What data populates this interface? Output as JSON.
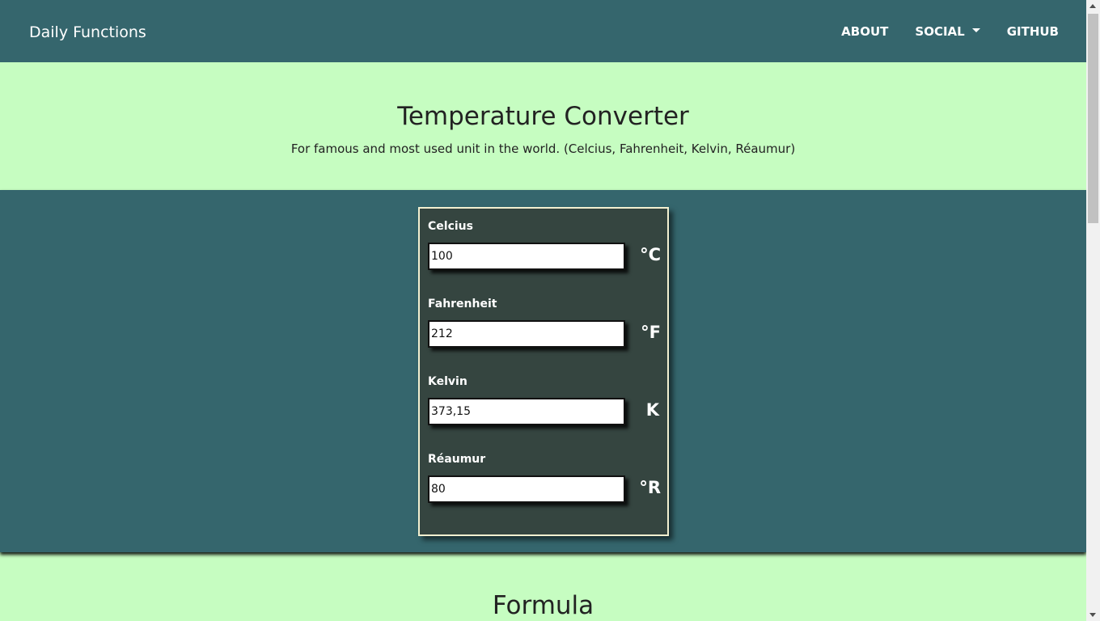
{
  "navbar": {
    "brand": "Daily Functions",
    "links": [
      {
        "label": "ABOUT"
      },
      {
        "label": "SOCIAL"
      },
      {
        "label": "GITHUB"
      }
    ]
  },
  "hero": {
    "title": "Temperature Converter",
    "subtitle": "For famous and most used unit in the world. (Celcius, Fahrenheit, Kelvin, Réaumur)"
  },
  "converter": {
    "fields": [
      {
        "label": "Celcius",
        "value": "100",
        "unit": "°C"
      },
      {
        "label": "Fahrenheit",
        "value": "212",
        "unit": "°F"
      },
      {
        "label": "Kelvin",
        "value": "373,15",
        "unit": "K"
      },
      {
        "label": "Réaumur",
        "value": "80",
        "unit": "°R"
      }
    ]
  },
  "formula": {
    "title": "Formula"
  },
  "colors": {
    "navbar_bg": "#35666d",
    "page_bg": "#c6fdc1",
    "card_bg": "#354540",
    "card_border": "#f2f0d0"
  },
  "icons": {
    "dropdown": "caret-down-icon"
  }
}
